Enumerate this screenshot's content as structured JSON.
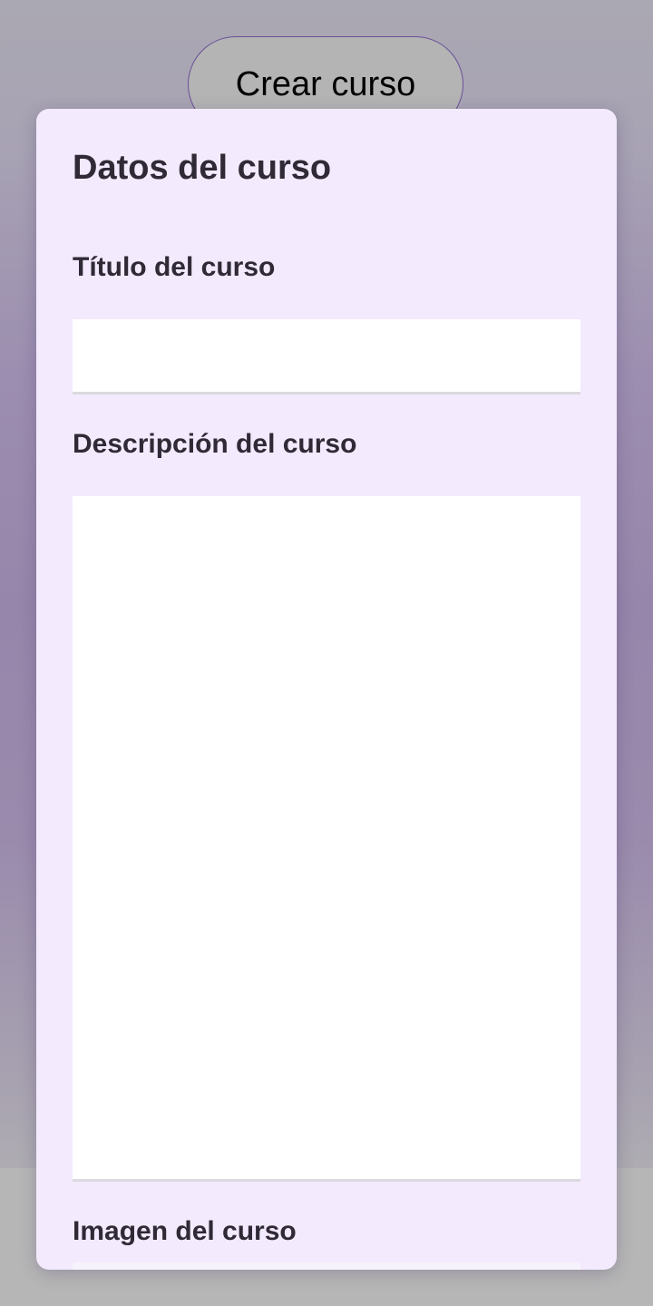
{
  "header": {
    "create_button_label": "Crear curso"
  },
  "dialog": {
    "title": "Datos del curso",
    "fields": [
      {
        "label": "Título del curso",
        "value": "",
        "placeholder": ""
      },
      {
        "label": "Descripción del curso",
        "value": "",
        "placeholder": ""
      },
      {
        "label": "Imagen del curso"
      }
    ]
  }
}
